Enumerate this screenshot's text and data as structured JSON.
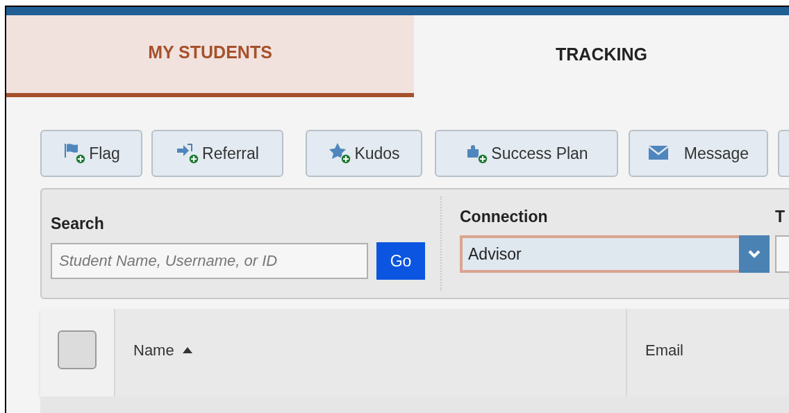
{
  "tabs": [
    {
      "label": "MY STUDENTS",
      "selected": true
    },
    {
      "label": "TRACKING",
      "selected": false
    }
  ],
  "toolbar": [
    {
      "kind": "flag",
      "label": "Flag"
    },
    {
      "kind": "referral",
      "label": "Referral"
    },
    {
      "kind": "kudos",
      "label": "Kudos"
    },
    {
      "kind": "plan",
      "label": "Success Plan"
    },
    {
      "kind": "message",
      "label": "Message"
    },
    {
      "kind": "cut"
    }
  ],
  "filters": [
    {
      "kind": "search",
      "label": "Search",
      "placeholder": "Student Name, Username, or ID",
      "button": "Go"
    },
    {
      "kind": "select",
      "label": "Connection",
      "value": "Advisor",
      "focused": true
    },
    {
      "kind": "cut",
      "label": "T"
    }
  ],
  "table": {
    "select_all": {
      "checked": false
    },
    "columns": [
      {
        "label": "Name",
        "sorted": true
      },
      {
        "label": "Email"
      }
    ]
  }
}
